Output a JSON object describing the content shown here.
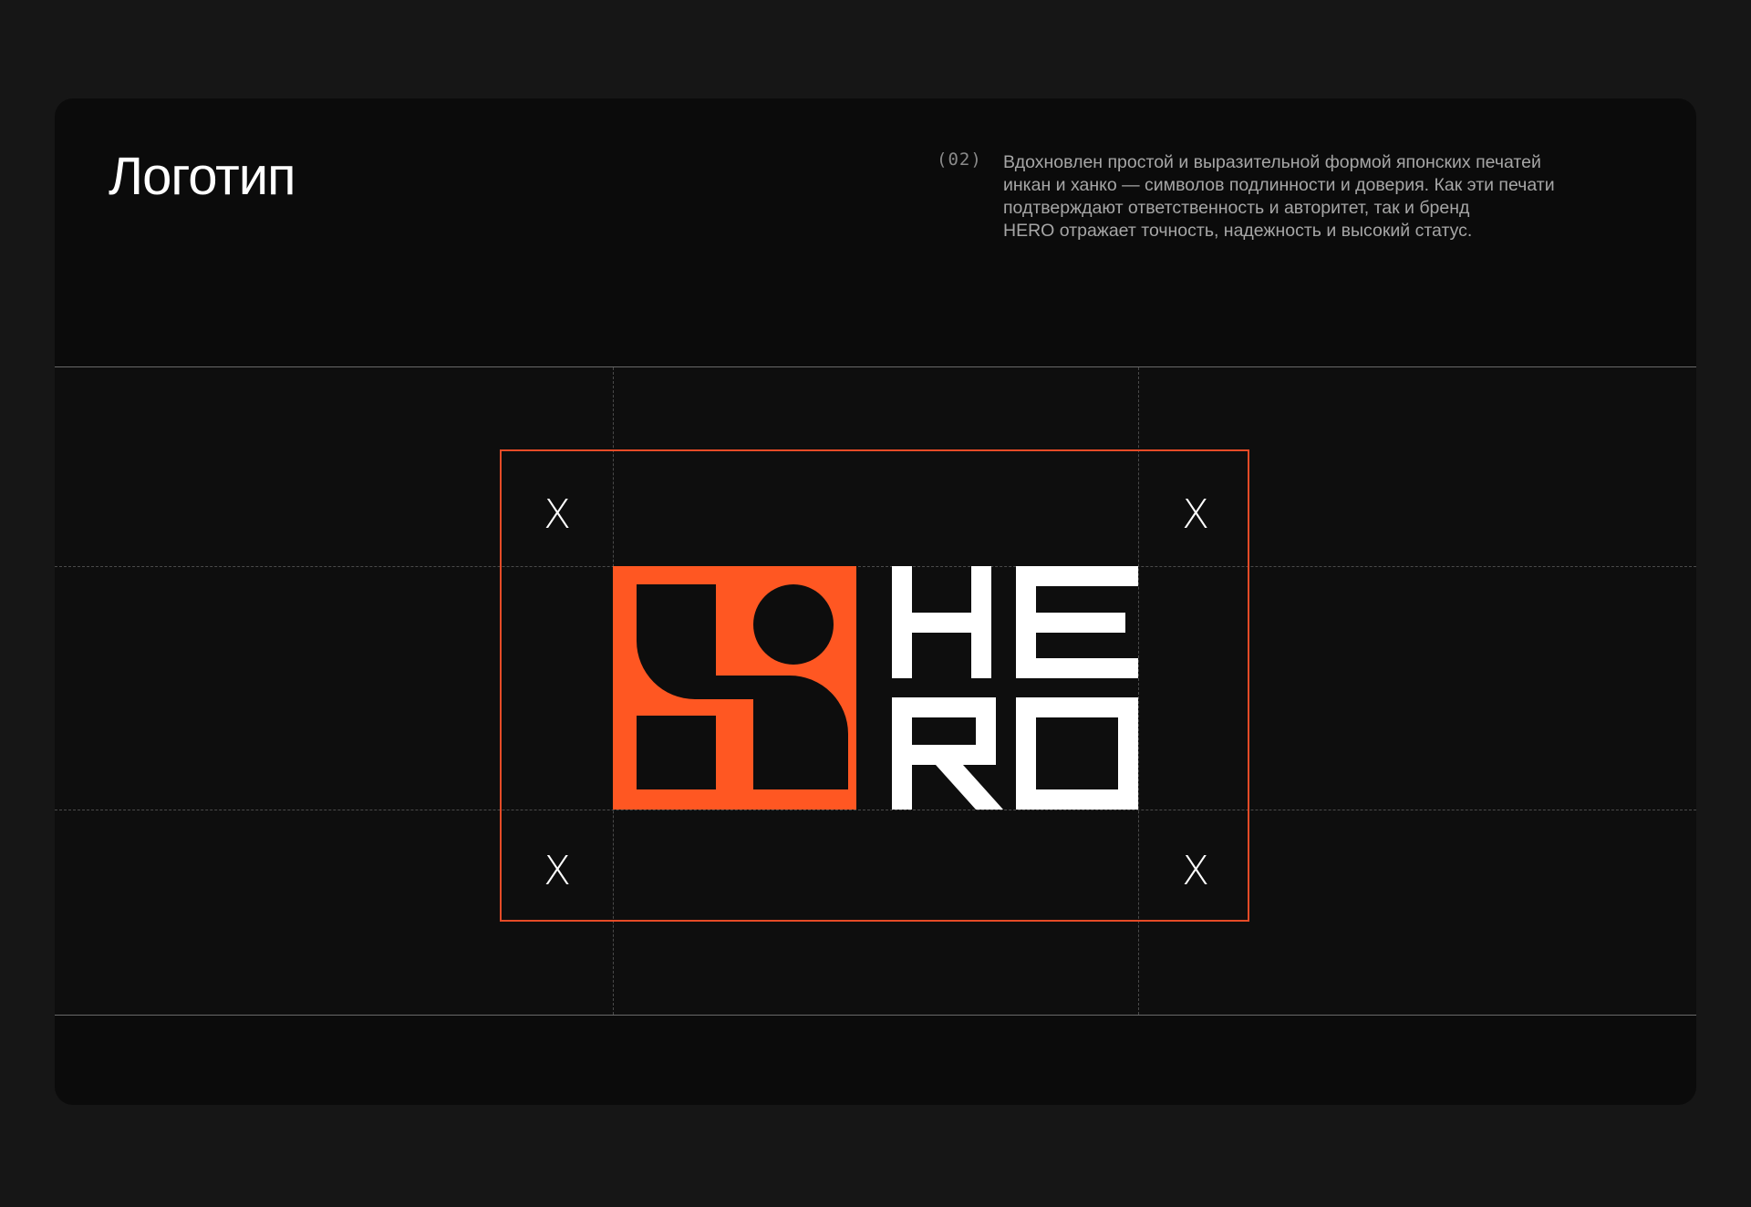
{
  "header": {
    "title": "Логотип",
    "section_number": "(02)",
    "description_lines": [
      "Вдохновлен простой и выразительной формой японских печатей",
      "инкан и ханко — символов подлинности и доверия. Как эти печати",
      "подтверждают ответственность и авторитет, так и бренд",
      "HERO отражает точность, надежность и высокий статус."
    ]
  },
  "construction": {
    "clearspace_marks": [
      "X",
      "X",
      "X",
      "X"
    ]
  },
  "logo": {
    "wordmark": "HERO",
    "symbol_icon": "hanko-seal-icon"
  },
  "colors": {
    "page_background": "#161616",
    "card_background": "#0b0b0b",
    "accent_orange": "#ff5722",
    "clearspace_border": "#e54b27",
    "text_primary": "#ffffff",
    "text_secondary": "#a6a6a6"
  }
}
